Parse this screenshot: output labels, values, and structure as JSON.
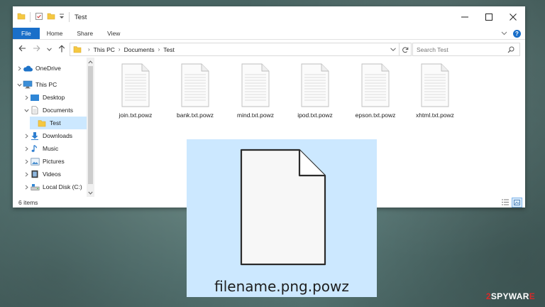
{
  "window": {
    "title": "Test",
    "controls": {
      "minimize": "–",
      "maximize": "☐",
      "close": "✕"
    }
  },
  "ribbon": {
    "tabs": [
      "File",
      "Home",
      "Share",
      "View"
    ]
  },
  "address": {
    "crumbs": [
      "This PC",
      "Documents",
      "Test"
    ],
    "search_placeholder": "Search Test"
  },
  "nav": {
    "items": [
      {
        "label": "OneDrive",
        "icon": "cloud-icon",
        "expand": "collapsed",
        "indent": 0,
        "selected": false
      },
      {
        "label": "This PC",
        "icon": "computer-icon",
        "expand": "expanded",
        "indent": 0,
        "selected": false
      },
      {
        "label": "Desktop",
        "icon": "desktop-icon",
        "expand": "collapsed",
        "indent": 1,
        "selected": false
      },
      {
        "label": "Documents",
        "icon": "documents-icon",
        "expand": "expanded",
        "indent": 1,
        "selected": false
      },
      {
        "label": "Test",
        "icon": "folder-icon",
        "expand": "none",
        "indent": 2,
        "selected": true
      },
      {
        "label": "Downloads",
        "icon": "download-icon",
        "expand": "collapsed",
        "indent": 1,
        "selected": false
      },
      {
        "label": "Music",
        "icon": "music-icon",
        "expand": "collapsed",
        "indent": 1,
        "selected": false
      },
      {
        "label": "Pictures",
        "icon": "pictures-icon",
        "expand": "collapsed",
        "indent": 1,
        "selected": false
      },
      {
        "label": "Videos",
        "icon": "videos-icon",
        "expand": "collapsed",
        "indent": 1,
        "selected": false
      },
      {
        "label": "Local Disk (C:)",
        "icon": "disk-icon",
        "expand": "collapsed",
        "indent": 1,
        "selected": false
      }
    ]
  },
  "files": [
    {
      "name": "join.txt.powz"
    },
    {
      "name": "bank.txt.powz"
    },
    {
      "name": "mind.txt.powz"
    },
    {
      "name": "ipod.txt.powz"
    },
    {
      "name": "epson.txt.powz"
    },
    {
      "name": "xhtml.txt.powz"
    }
  ],
  "status": {
    "count": "6 items"
  },
  "preview": {
    "filename": "filename.png.powz"
  },
  "watermark": {
    "num": "2",
    "text": "SPYWAR",
    "end": "E"
  },
  "colors": {
    "accent": "#1a6fc9",
    "selection": "#cce8ff",
    "folder": "#f5c842"
  }
}
